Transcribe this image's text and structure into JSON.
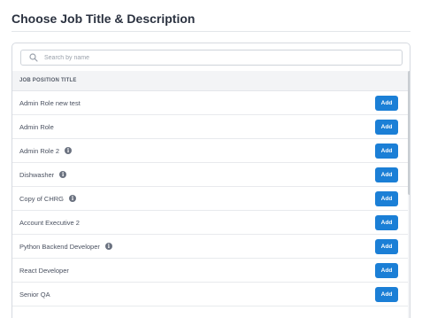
{
  "page": {
    "title": "Choose Job Title & Description"
  },
  "search": {
    "placeholder": "Search by name",
    "value": ""
  },
  "table": {
    "column_header": "JOB POSITION TITLE",
    "add_label": "Add",
    "rows": [
      {
        "title": "Admin Role new test",
        "has_info": false
      },
      {
        "title": "Admin Role",
        "has_info": false
      },
      {
        "title": "Admin Role 2",
        "has_info": true
      },
      {
        "title": "Dishwasher",
        "has_info": true
      },
      {
        "title": "Copy of CHRG",
        "has_info": true
      },
      {
        "title": "Account Executive 2",
        "has_info": false
      },
      {
        "title": "Python Backend Developer",
        "has_info": true
      },
      {
        "title": "React Developer",
        "has_info": false
      },
      {
        "title": "Senior QA",
        "has_info": false
      }
    ]
  },
  "colors": {
    "accent": "#1b7fd6",
    "header_bg": "#f3f4f6",
    "info_icon": "#6b7280"
  },
  "icons": {
    "search": "search-icon",
    "info": "info-icon"
  }
}
